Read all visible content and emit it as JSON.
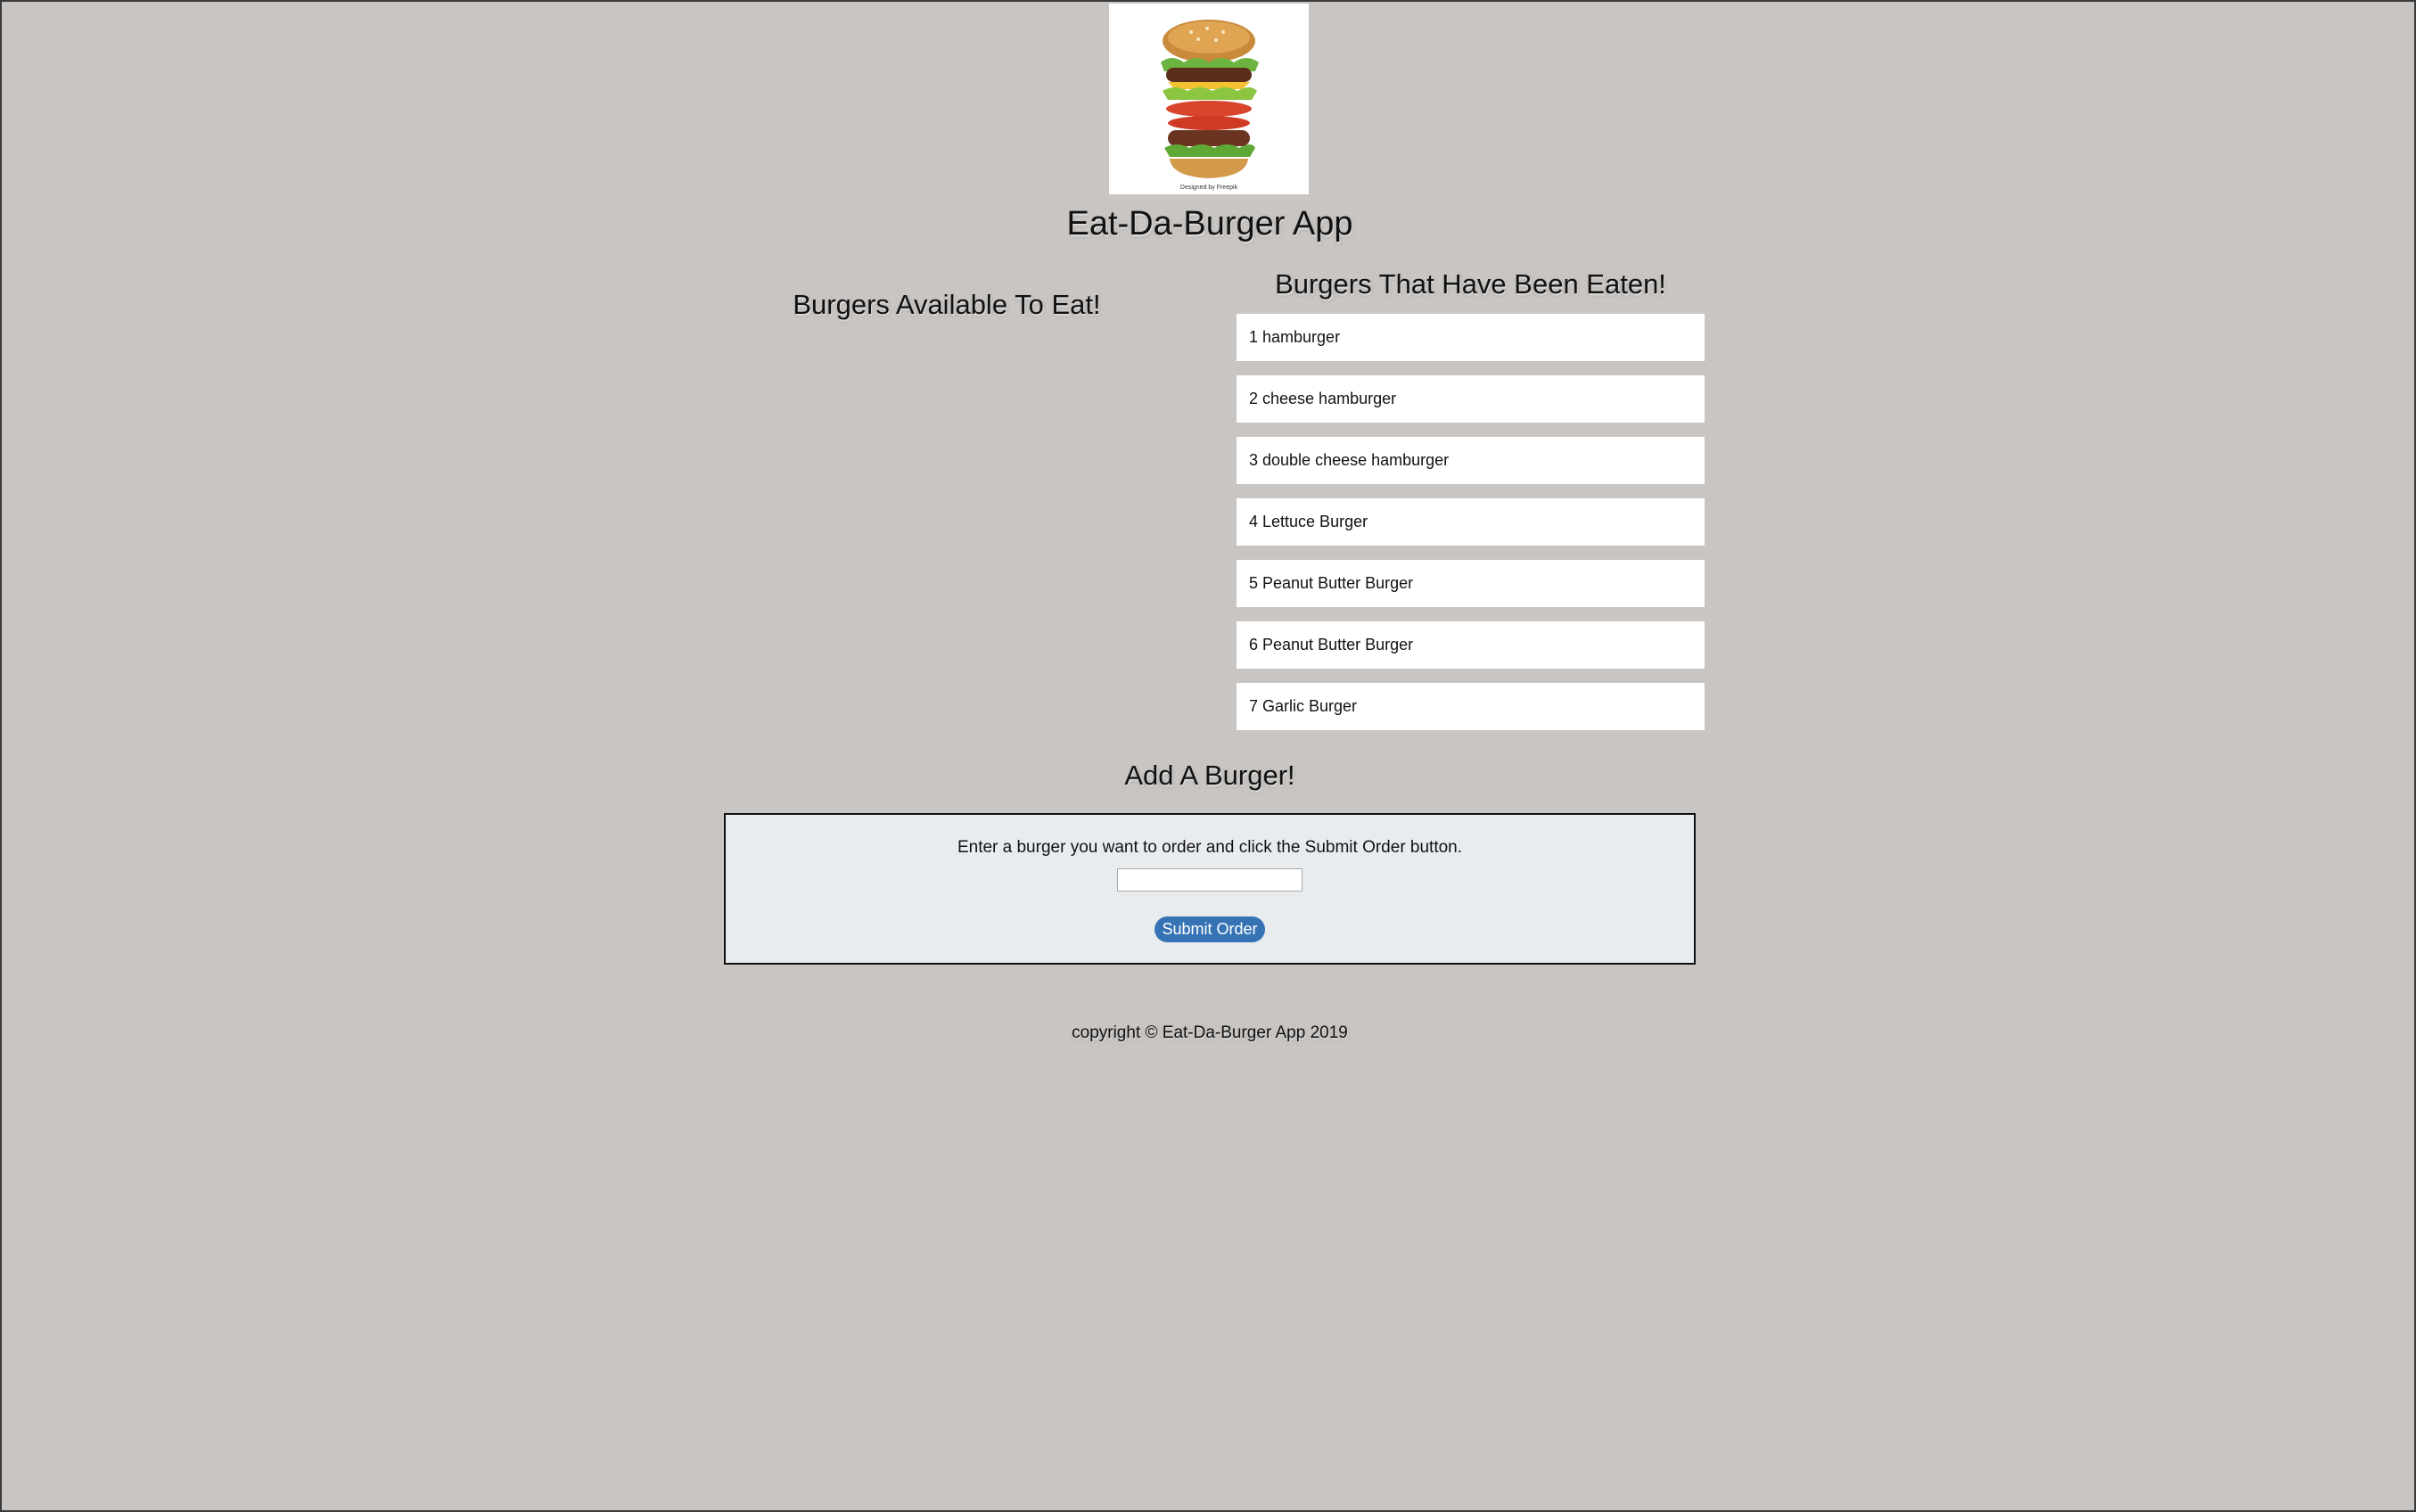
{
  "logo": {
    "alt": "Burger stack logo",
    "credit": "Designed by Freepik"
  },
  "header": {
    "title": "Eat-Da-Burger App"
  },
  "available": {
    "heading": "Burgers Available To Eat!",
    "items": []
  },
  "eaten": {
    "heading": "Burgers That Have Been Eaten!",
    "items": [
      "1 hamburger",
      "2 cheese hamburger",
      "3 double cheese hamburger",
      "4 Lettuce Burger",
      "5 Peanut Butter Burger",
      "6 Peanut Butter Burger",
      "7 Garlic Burger"
    ]
  },
  "add": {
    "heading": "Add A Burger!",
    "instruction": "Enter a burger you want to order and click the Submit Order button.",
    "input_value": "",
    "submit_label": "Submit Order"
  },
  "footer": {
    "copyright": "copyright © Eat-Da-Burger App 2019"
  },
  "colors": {
    "background": "#c9c5c2",
    "panel": "#e9ecef",
    "button": "#3573b5",
    "card": "#ffffff"
  }
}
